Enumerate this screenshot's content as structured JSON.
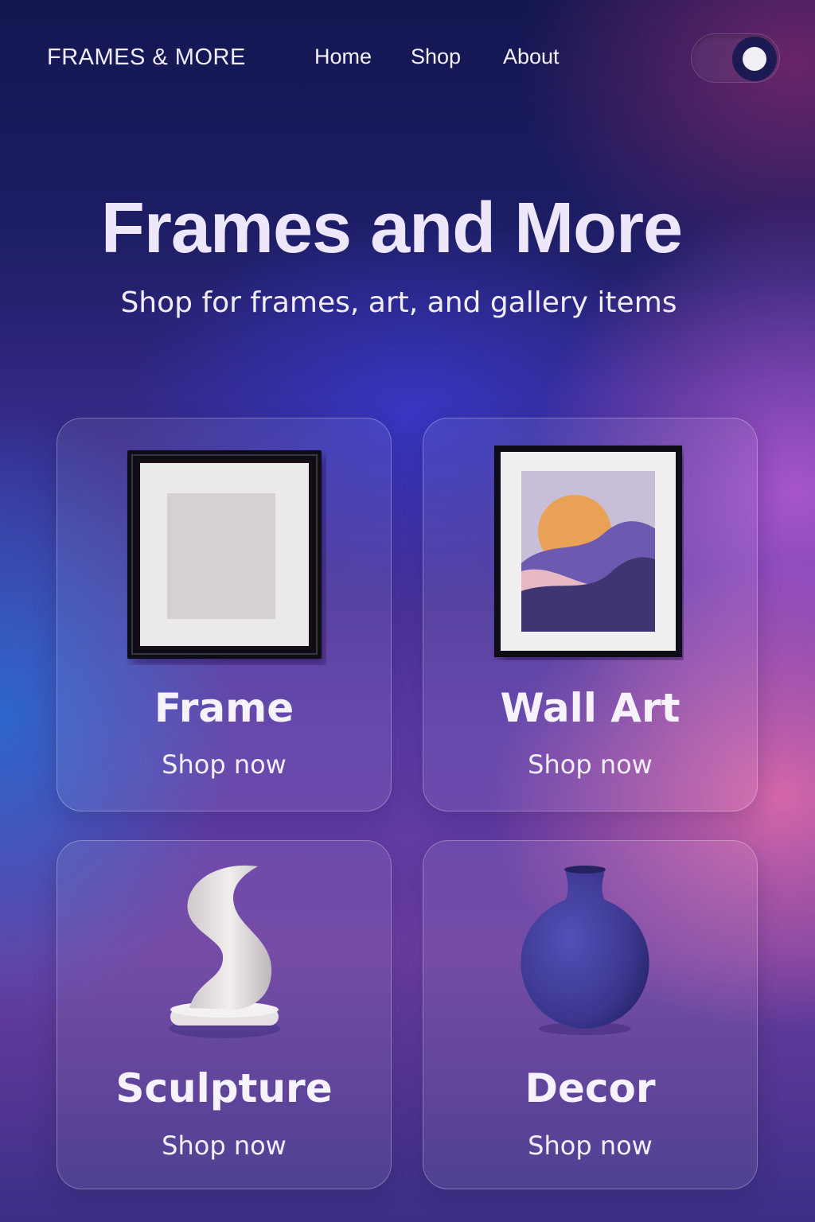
{
  "nav": {
    "logo": "FRAMES & MORE",
    "links": [
      {
        "label": "Home"
      },
      {
        "label": "Shop"
      },
      {
        "label": "About"
      }
    ],
    "theme_toggle": {
      "state": "on"
    }
  },
  "hero": {
    "title": "Frames and More",
    "subtitle": "Shop for frames, art, and gallery items"
  },
  "categories": [
    {
      "title": "Frame",
      "cta": "Shop now",
      "image_icon": "picture-frame-icon"
    },
    {
      "title": "Wall Art",
      "cta": "Shop now",
      "image_icon": "framed-artwork-icon"
    },
    {
      "title": "Sculpture",
      "cta": "Shop now",
      "image_icon": "sculpture-icon"
    },
    {
      "title": "Decor",
      "cta": "Shop now",
      "image_icon": "vase-icon"
    }
  ],
  "colors": {
    "background_top": "#131751",
    "background_accent_pink": "#ea6eaa",
    "background_accent_blue": "#266ed2",
    "text": "#f3eefc",
    "vase": "#3f3a9c",
    "art_sun": "#e9a255"
  }
}
